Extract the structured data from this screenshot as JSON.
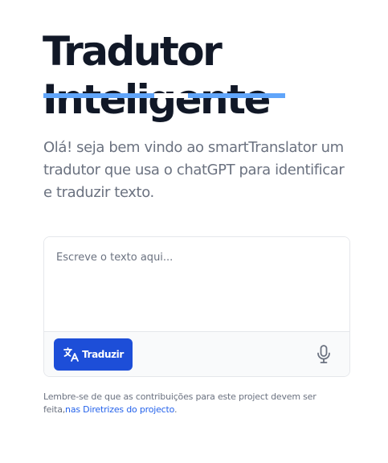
{
  "hero": {
    "title_line1": "Tradutor",
    "title_line2": "Inteligente",
    "subtitle": "Olá! seja bem vindo ao smartTranslator um tradutor que usa o chatGPT para identificar e traduzir texto."
  },
  "editor": {
    "placeholder": "Escreve o texto aqui...",
    "value": ""
  },
  "toolbar": {
    "translate_label": "Traduzir",
    "translate_icon": "translate-icon",
    "mic_icon": "microphone-icon"
  },
  "note": {
    "text": "Lembre-se de que as contribuições para este project devem ser feita,",
    "link_label": "nas Diretrizes do projecto",
    "suffix": "."
  },
  "colors": {
    "title": "#111827",
    "underline": "#60a5fa",
    "button": "#1d4ed8",
    "link": "#2563eb",
    "muted_text": "#6b7280"
  }
}
